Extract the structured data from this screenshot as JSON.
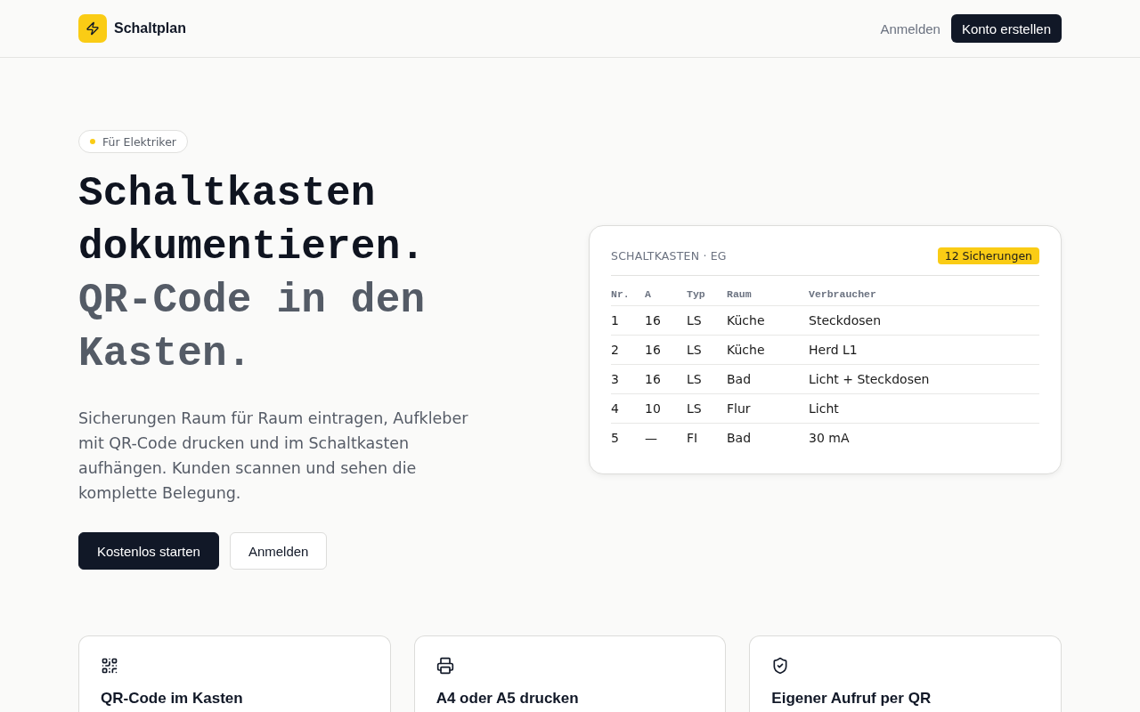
{
  "header": {
    "brand": "Schaltplan",
    "nav": [
      {
        "kind": "link",
        "label": "Anmelden"
      },
      {
        "kind": "button",
        "label": "Konto erstellen"
      }
    ]
  },
  "hero": {
    "tag": "Für Elektriker",
    "heading": "Schaltkasten dokumentieren.",
    "subheading": "QR-Code in den Kasten.",
    "description": "Sicherungen Raum für Raum eintragen, Aufkleber mit QR-Code drucken und im Schaltkasten aufhängen. Kunden scannen und sehen die komplette Belegung.",
    "actions": [
      {
        "kind": "primary",
        "label": "Kostenlos starten"
      },
      {
        "kind": "secondary",
        "label": "Anmelden"
      }
    ]
  },
  "panel": {
    "title": "SCHALTKASTEN · EG",
    "count_badge": "12 Sicherungen",
    "table": {
      "columns": [
        "Nr.",
        "A",
        "Typ",
        "Raum",
        "Verbraucher"
      ],
      "rows": [
        [
          "1",
          "16",
          "LS",
          "Küche",
          "Steckdosen"
        ],
        [
          "2",
          "16",
          "LS",
          "Küche",
          "Herd L1"
        ],
        [
          "3",
          "16",
          "LS",
          "Bad",
          "Licht + Steckdosen"
        ],
        [
          "4",
          "10",
          "LS",
          "Flur",
          "Licht"
        ],
        [
          "5",
          "—",
          "FI",
          "Bad",
          "30 mA"
        ]
      ]
    }
  },
  "features": [
    {
      "kind": "qr",
      "title": "QR-Code im Kasten"
    },
    {
      "kind": "printer",
      "title": "A4 oder A5 drucken"
    },
    {
      "kind": "shield",
      "title": "Eigener Aufruf per QR"
    }
  ]
}
